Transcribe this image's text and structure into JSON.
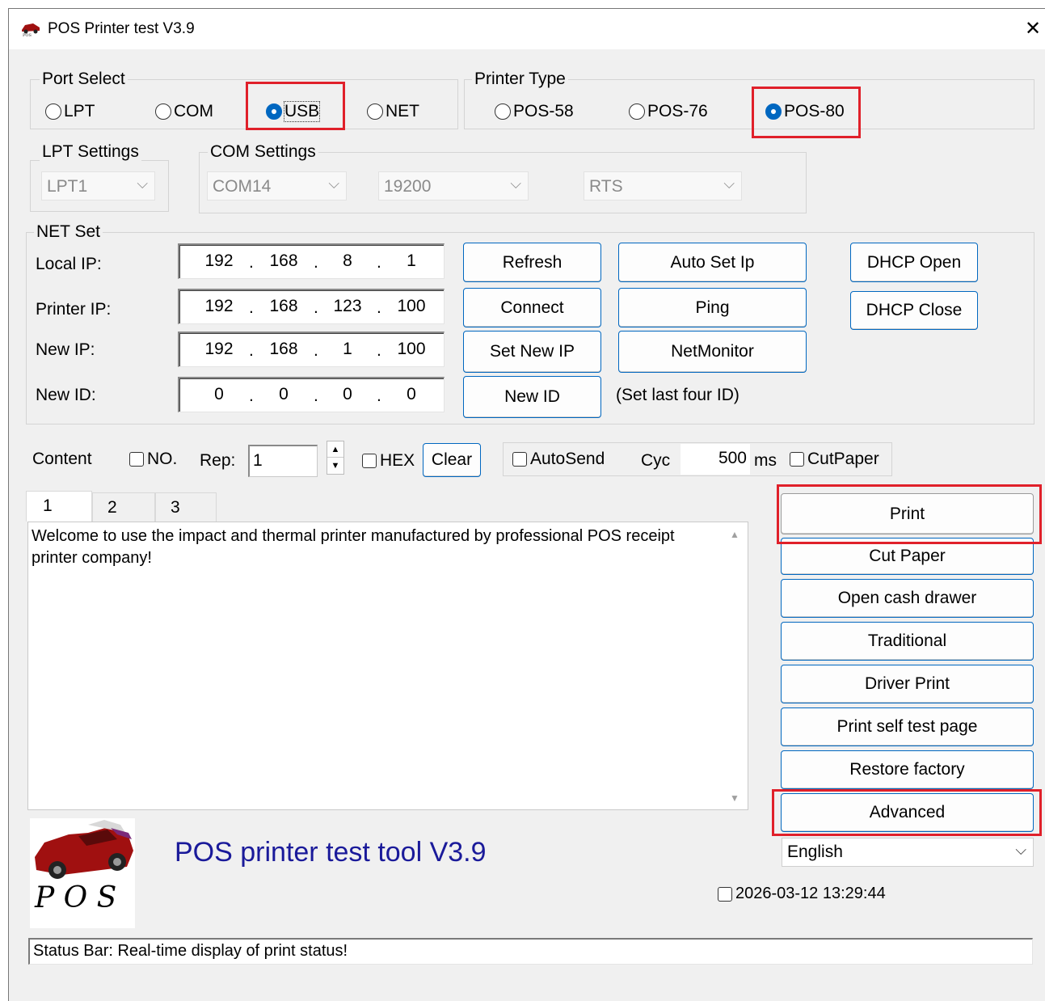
{
  "window": {
    "title": "POS Printer test V3.9",
    "close_glyph": "✕"
  },
  "port_select": {
    "group_title": "Port Select",
    "options": [
      "LPT",
      "COM",
      "USB",
      "NET"
    ],
    "selected": "USB"
  },
  "printer_type": {
    "group_title": "Printer Type",
    "options": [
      "POS-58",
      "POS-76",
      "POS-80"
    ],
    "selected": "POS-80"
  },
  "lpt_settings": {
    "group_title": "LPT Settings",
    "port": "LPT1"
  },
  "com_settings": {
    "group_title": "COM Settings",
    "port": "COM14",
    "baud": "19200",
    "flow": "RTS"
  },
  "net_set": {
    "group_title": "NET Set",
    "local_ip_label": "Local IP:",
    "printer_ip_label": "Printer IP:",
    "new_ip_label": "New IP:",
    "new_id_label": "New ID:",
    "local_ip": [
      "192",
      "168",
      "8",
      "1"
    ],
    "printer_ip": [
      "192",
      "168",
      "123",
      "100"
    ],
    "new_ip": [
      "192",
      "168",
      "1",
      "100"
    ],
    "new_id": [
      "0",
      "0",
      "0",
      "0"
    ],
    "ip_dot": ".",
    "buttons": {
      "refresh": "Refresh",
      "auto_set_ip": "Auto Set Ip",
      "dhcp_open": "DHCP Open",
      "connect": "Connect",
      "ping": "Ping",
      "dhcp_close": "DHCP Close",
      "set_new_ip": "Set New IP",
      "net_monitor": "NetMonitor",
      "new_id": "New ID"
    },
    "new_id_note": "(Set last four ID)"
  },
  "content_bar": {
    "content_label": "Content",
    "no_label": "NO.",
    "rep_label": "Rep:",
    "rep_value": "1",
    "hex_label": "HEX",
    "clear_button": "Clear",
    "autosend_label": "AutoSend",
    "cyc_label": "Cyc",
    "cyc_value": "500",
    "ms_label": "ms",
    "cutpaper_label": "CutPaper"
  },
  "tabs": [
    "1",
    "2",
    "3"
  ],
  "content_text": "Welcome to use the impact and thermal printer manufactured by professional POS receipt printer company!",
  "actions": {
    "print": "Print",
    "cut_paper": "Cut Paper",
    "open_cash_drawer": "Open cash drawer",
    "traditional": "Traditional",
    "driver_print": "Driver Print",
    "print_self_test": "Print self test page",
    "restore_factory": "Restore factory",
    "advanced": "Advanced"
  },
  "language": "English",
  "footer": {
    "tool_title": "POS printer test tool V3.9",
    "logo_text": "P O S",
    "datetime": "2026-03-12 13:29:44",
    "status_bar": "Status Bar: Real-time display of print status!"
  },
  "colors": {
    "accent": "#0067c0",
    "highlight": "#e0202a",
    "title_blue": "#1a1a9a",
    "car_red": "#a01010"
  }
}
